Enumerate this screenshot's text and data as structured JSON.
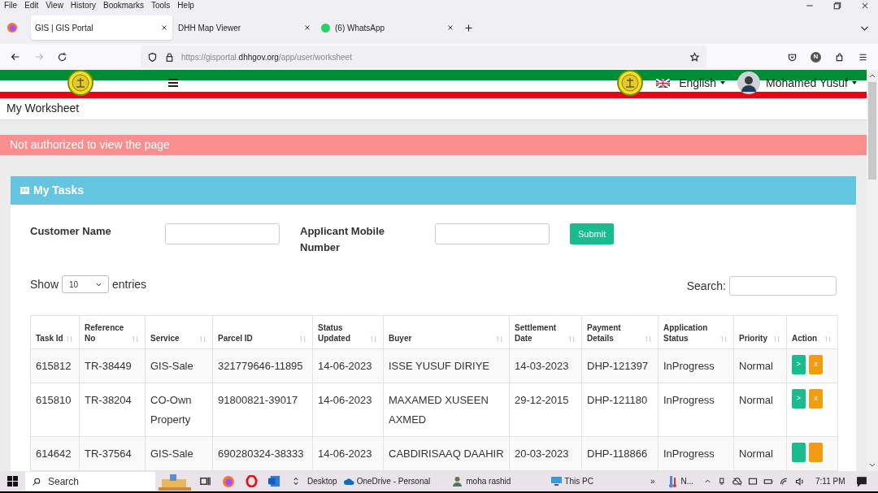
{
  "browser": {
    "menu": [
      "File",
      "Edit",
      "View",
      "History",
      "Bookmarks",
      "Tools",
      "Help"
    ],
    "tabs": [
      {
        "title": "GIS | GIS Portal",
        "selected": true,
        "kind": "plain"
      },
      {
        "title": "DHH Map Viewer",
        "selected": false,
        "kind": "plain"
      },
      {
        "title": "(6) WhatsApp",
        "selected": false,
        "kind": "chat"
      }
    ],
    "url": {
      "host_start": "https://gisportal.",
      "domain": "dhhgov.org",
      "path": "/app/user/worksheet"
    },
    "forward_disabled": true,
    "profile_initial": "N"
  },
  "page": {
    "header": {
      "language": "English",
      "user": "Mohamed Yusuf"
    },
    "title": "My Worksheet",
    "alert": "Not authorized to view the page",
    "panel": {
      "title": "My Tasks",
      "filters": [
        {
          "label": "Customer Name"
        },
        {
          "label": "Applicant Mobile Number"
        }
      ],
      "submit": "Submit",
      "length": {
        "show": "Show",
        "value": "10",
        "entries": "entries"
      },
      "search_label": "Search:",
      "table": {
        "columns": [
          "Task Id",
          "Reference No",
          "Service",
          "Parcel ID",
          "Status Updated",
          "Buyer",
          "Settlement Date",
          "Payment Details",
          "Application Status",
          "Priority",
          "Action"
        ],
        "rows": [
          {
            "cells": [
              "615812",
              "TR-38449",
              "GIS-Sale",
              "321779646-11895",
              "14-06-2023",
              "ISSE YUSUF DIRIYE",
              "14-03-2023",
              "DHP-121397",
              "InProgress",
              "Normal"
            ],
            "actions": [
              {
                "kind": "open",
                "label": ">"
              },
              {
                "kind": "remove",
                "label": "x"
              }
            ]
          },
          {
            "cells": [
              "615810",
              "TR-38204",
              "CO-Own Property",
              "91800821-39017",
              "14-06-2023",
              "MAXAMED XUSEEN AXMED",
              "29-12-2015",
              "DHP-121180",
              "InProgress",
              "Normal"
            ],
            "actions": [
              {
                "kind": "open",
                "label": ">"
              },
              {
                "kind": "remove",
                "label": "x"
              }
            ]
          },
          {
            "cells": [
              "614642",
              "TR-37564",
              "GIS-Sale",
              "690280324-38333",
              "14-06-2023",
              "CABDIRISAAQ DAAHIR",
              "20-03-2023",
              "DHP-118866",
              "InProgress",
              "Normal"
            ],
            "actions": [
              {
                "kind": "open"
              },
              {
                "kind": "remove"
              }
            ]
          }
        ]
      }
    }
  },
  "taskbar": {
    "search": "Search",
    "labels": [
      {
        "kind": "desktop",
        "label": "Desktop"
      },
      {
        "kind": "onedrive",
        "label": "OneDrive - Personal"
      },
      {
        "kind": "person",
        "label": "moha rashid"
      },
      {
        "kind": "pc",
        "label": "This PC"
      },
      {
        "kind": "more",
        "label": "»"
      },
      {
        "kind": "weather",
        "label": "N..."
      }
    ],
    "time": "7:11 PM"
  }
}
